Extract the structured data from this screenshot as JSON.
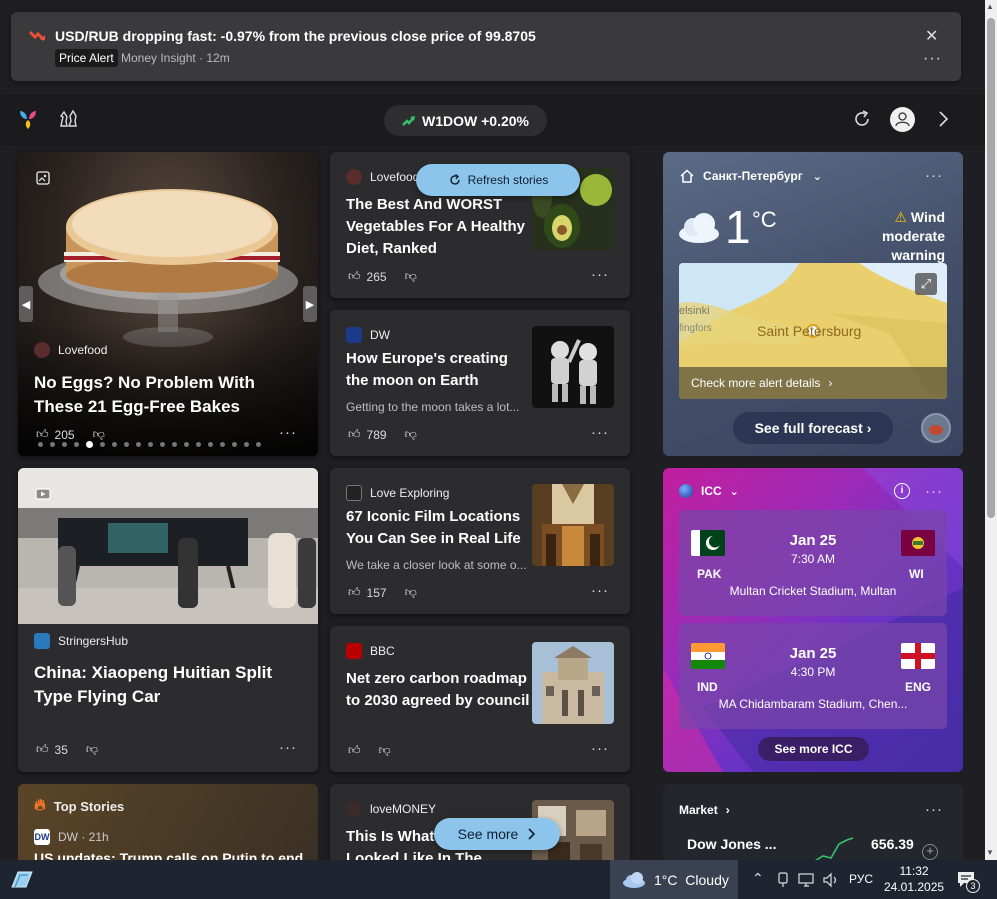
{
  "notification": {
    "title": "USD/RUB dropping fast: -0.97% from the previous close price of 99.8705",
    "tag": "Price Alert",
    "meta": "Money Insight · 12m",
    "close": "✕",
    "more": "···"
  },
  "toolbar": {
    "ticker_label": "W1DOW +0.20%"
  },
  "refresh_pill": {
    "label": "Refresh stories"
  },
  "see_more_pill": {
    "label": "See more"
  },
  "cards": {
    "cake": {
      "source": "Lovefood",
      "headline": "No Eggs? No Problem With These 21 Egg-Free Bakes",
      "likes": "205"
    },
    "vegetables": {
      "source": "Lovefood",
      "headline": "The Best And WORST Vegetables For A Healthy Diet, Ranked",
      "likes": "265"
    },
    "moon": {
      "source": "DW",
      "headline": "How Europe's creating the moon on Earth",
      "snippet": "Getting to the moon takes a lot...",
      "likes": "789"
    },
    "flying_car": {
      "source": "StringersHub",
      "headline": "China: Xiaopeng Huitian Split Type Flying Car",
      "likes": "35"
    },
    "film": {
      "source": "Love Exploring",
      "headline": "67 Iconic Film Locations You Can See in Real Life",
      "snippet": "We take a closer look at some o...",
      "likes": "157"
    },
    "carbon": {
      "source": "BBC",
      "headline": "Net zero carbon roadmap to 2030 agreed by council"
    },
    "top_stories": {
      "section": "Top Stories",
      "source_meta": "DW · 21h",
      "headline": "US updates: Trump calls on Putin to end"
    },
    "lovemoney": {
      "source": "loveMONEY",
      "headline": "This Is What ... Looked Like In The"
    }
  },
  "weather": {
    "city": "Санкт-Петербург",
    "temp": "1",
    "unit": "°C",
    "warning_title": "Wind",
    "warning_sub": "moderate warning",
    "map_label_city": "Saint Petersburg",
    "map_label_left": "elsinki",
    "map_label_left2": "fingfors",
    "alert_link": "Check more alert details",
    "forecast_btn": "See full forecast"
  },
  "icc": {
    "title": "ICC",
    "matches": [
      {
        "date": "Jan 25",
        "time": "7:30 AM",
        "team1": "PAK",
        "team2": "WI",
        "venue": "Multan Cricket Stadium, Multan"
      },
      {
        "date": "Jan 25",
        "time": "4:30 PM",
        "team1": "IND",
        "team2": "ENG",
        "venue": "MA Chidambaram Stadium, Chen..."
      }
    ],
    "see_more": "See more ICC"
  },
  "market": {
    "title": "Market",
    "name": "Dow Jones ...",
    "value": "656.39"
  },
  "taskbar": {
    "weather": "1°C  Cloudy",
    "lang": "РУС",
    "time": "11:32",
    "date": "24.01.2025",
    "notif_count": "3"
  },
  "colors": {
    "accent_blue": "#8cc4ec",
    "up_green": "#35c46a",
    "icc_magenta": "#c21e9e"
  }
}
